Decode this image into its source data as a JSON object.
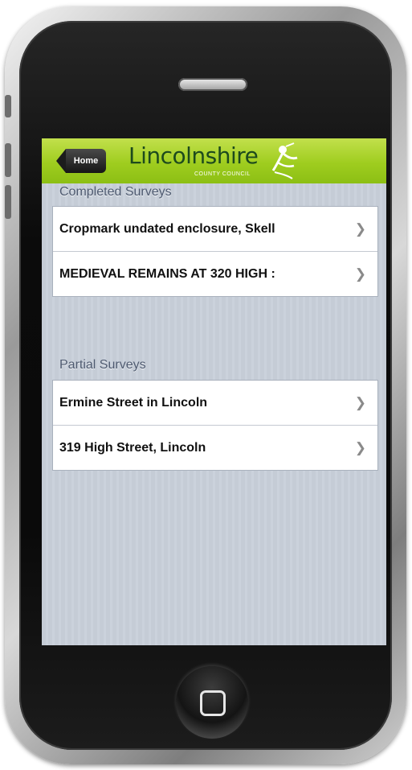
{
  "app": {
    "home_label": "Home",
    "logo_text": "Lincolnshire",
    "logo_subtext": "COUNTY COUNCIL"
  },
  "sections": [
    {
      "title": "Completed Surveys",
      "items": [
        {
          "label": "Cropmark undated enclosure, Skell"
        },
        {
          "label": "MEDIEVAL REMAINS AT 320 HIGH :"
        }
      ]
    },
    {
      "title": "Partial Surveys",
      "items": [
        {
          "label": "Ermine Street in Lincoln"
        },
        {
          "label": "319 High Street, Lincoln"
        }
      ]
    }
  ],
  "icons": {
    "chevron": "chevron-right-icon",
    "back": "back-arrow-icon",
    "home_hardware": "home-button-icon"
  },
  "colors": {
    "navbar": "#9fcd1f",
    "logo_text": "#1d4a1d",
    "section_title": "#4e5a70",
    "row_text": "#111111",
    "screen_background": "#c5ccd6"
  }
}
